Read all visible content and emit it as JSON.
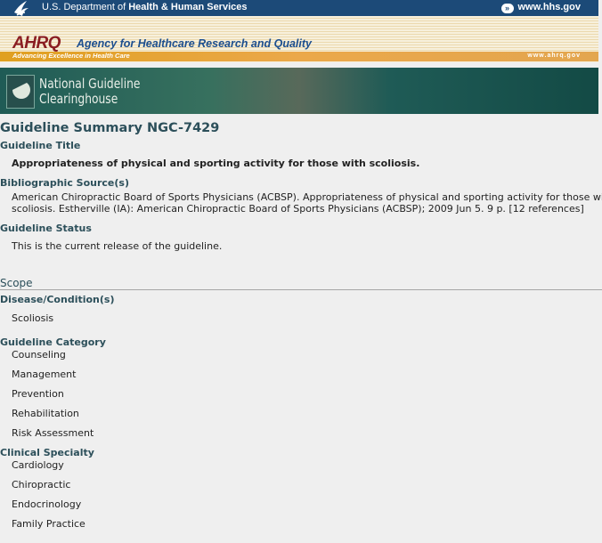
{
  "hhs": {
    "dept_prefix": "U.S. Department of ",
    "dept_bold": "Health & Human Services",
    "link_label": "www.hhs.gov",
    "icon": "hhs-eagle-icon"
  },
  "ahrq": {
    "logo": "AHRQ",
    "name": "Agency for Healthcare Research and Quality",
    "tagline": "Advancing Excellence in Health Care",
    "url": "www.ahrq.gov"
  },
  "ngc": {
    "line1": "National Guideline",
    "line2": "Clearinghouse"
  },
  "summary": {
    "title": "Guideline Summary NGC-7429",
    "guideline_title_label": "Guideline Title",
    "guideline_title": "Appropriateness of physical and sporting activity for those with scoliosis.",
    "biblio_label": "Bibliographic Source(s)",
    "biblio_line1": "American Chiropractic Board of Sports Physicians (ACBSP). Appropriateness of physical and sporting activity for those with",
    "biblio_line2": "scoliosis. Estherville (IA): American Chiropractic Board of Sports Physicians (ACBSP); 2009 Jun 5. 9 p. [12 references]",
    "status_label": "Guideline Status",
    "status_text": "This is the current release of the guideline."
  },
  "scope": {
    "heading": "Scope",
    "disease_label": "Disease/Condition(s)",
    "disease": "Scoliosis",
    "category_label": "Guideline Category",
    "categories": [
      "Counseling",
      "Management",
      "Prevention",
      "Rehabilitation",
      "Risk Assessment"
    ],
    "specialty_label": "Clinical Specialty",
    "specialties": [
      "Cardiology",
      "Chiropractic",
      "Endocrinology",
      "Family Practice"
    ]
  },
  "colors": {
    "hhs_bar": "#1c4a78",
    "heading": "#2c4f5a",
    "ahrq_red": "#8a1d22",
    "ahrq_blue": "#1d4f8f"
  }
}
